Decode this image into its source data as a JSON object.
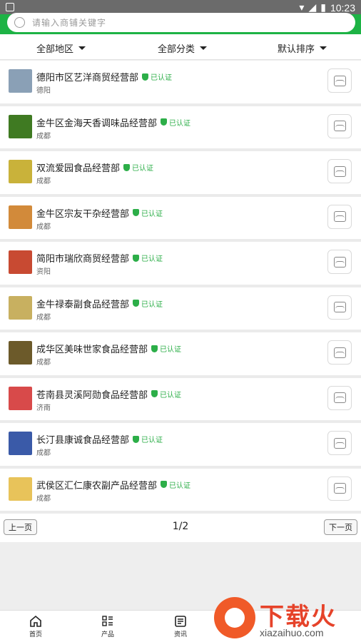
{
  "status_bar": {
    "time": "10:23"
  },
  "search": {
    "placeholder": "请输入商铺关键字"
  },
  "filters": [
    {
      "label": "全部地区"
    },
    {
      "label": "全部分类"
    },
    {
      "label": "默认排序"
    }
  ],
  "shops": [
    {
      "name": "德阳市区艺洋商贸经营部",
      "cert": "已认证",
      "city": "德阳",
      "thumb_color": "#8aa0b6"
    },
    {
      "name": "金牛区金海天香调味品经营部",
      "cert": "已认证",
      "city": "成都",
      "thumb_color": "#3f7a22"
    },
    {
      "name": "双流爱园食品经营部",
      "cert": "已认证",
      "city": "成都",
      "thumb_color": "#c9b23a"
    },
    {
      "name": "金牛区宗友干杂经营部",
      "cert": "已认证",
      "city": "成都",
      "thumb_color": "#d28a3a"
    },
    {
      "name": "简阳市瑞欣商贸经营部",
      "cert": "已认证",
      "city": "资阳",
      "thumb_color": "#c84a32"
    },
    {
      "name": "金牛禄泰副食品经营部",
      "cert": "已认证",
      "city": "成都",
      "thumb_color": "#c8b060"
    },
    {
      "name": "成华区美味世家食品经营部",
      "cert": "已认证",
      "city": "成都",
      "thumb_color": "#6c5a2a"
    },
    {
      "name": "苍南县灵溪阿勋食品经营部",
      "cert": "已认证",
      "city": "济南",
      "thumb_color": "#d84a4a"
    },
    {
      "name": "长汀县康诚食品经营部",
      "cert": "已认证",
      "city": "成都",
      "thumb_color": "#3a5aa8"
    },
    {
      "name": "武侯区汇仁康农副产品经营部",
      "cert": "已认证",
      "city": "成都",
      "thumb_color": "#e8c35a"
    }
  ],
  "pager": {
    "prev": "上一页",
    "count": "1/2",
    "next": "下一页"
  },
  "tabs": [
    {
      "label": "首页",
      "icon": "home-icon"
    },
    {
      "label": "产品",
      "icon": "grid-list-icon"
    },
    {
      "label": "资讯",
      "icon": "news-icon"
    }
  ],
  "watermark": {
    "title": "下载火",
    "url": "xiazaihuo.com"
  }
}
